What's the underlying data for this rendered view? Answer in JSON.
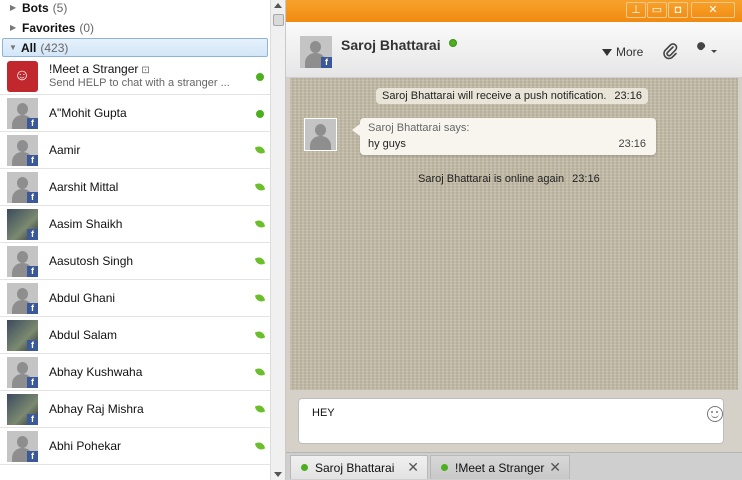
{
  "groups": {
    "bots": {
      "label": "Bots",
      "count": "(5)"
    },
    "favorites": {
      "label": "Favorites",
      "count": "(0)"
    },
    "all": {
      "label": "All",
      "count": "(423)"
    }
  },
  "bot_contact": {
    "name": "!Meet a Stranger",
    "subtitle": "Send HELP to chat with a stranger ...",
    "icon": "robot-tag-icon"
  },
  "contacts": [
    {
      "name": "A\"Mohit Gupta",
      "status": "online",
      "photo": false
    },
    {
      "name": "Aamir",
      "status": "mobile",
      "photo": false
    },
    {
      "name": "Aarshit Mittal",
      "status": "mobile",
      "photo": false
    },
    {
      "name": "Aasim Shaikh",
      "status": "mobile",
      "photo": true
    },
    {
      "name": "Aasutosh Singh",
      "status": "mobile",
      "photo": false
    },
    {
      "name": "Abdul Ghani",
      "status": "mobile",
      "photo": false
    },
    {
      "name": "Abdul Salam",
      "status": "mobile",
      "photo": true
    },
    {
      "name": "Abhay Kushwaha",
      "status": "mobile",
      "photo": false
    },
    {
      "name": "Abhay Raj Mishra",
      "status": "mobile",
      "photo": true
    },
    {
      "name": "Abhi Pohekar",
      "status": "mobile",
      "photo": false
    }
  ],
  "window": {
    "buttons": {
      "pin": "⊥",
      "min": "▭",
      "max": "◘",
      "close": "✕"
    }
  },
  "chat": {
    "partner_name": "Saroj Bhattarai",
    "more_label": "More",
    "push_notice": "Saroj Bhattarai will receive a push notification.",
    "push_time": "23:16",
    "message_sender": "Saroj Bhattarai says:",
    "message_text": "hy guys",
    "message_time": "23:16",
    "online_notice": "Saroj Bhattarai is online again",
    "online_time": "23:16",
    "composer_value": "HEY"
  },
  "tabs": [
    {
      "label": "Saroj Bhattarai",
      "close": "✕"
    },
    {
      "label": "!Meet a Stranger",
      "close": "✕"
    }
  ],
  "colors": {
    "titlebar": "#f08a12",
    "online": "#4caf1f",
    "facebook": "#3b5998",
    "selection": "#d3e6f7"
  }
}
